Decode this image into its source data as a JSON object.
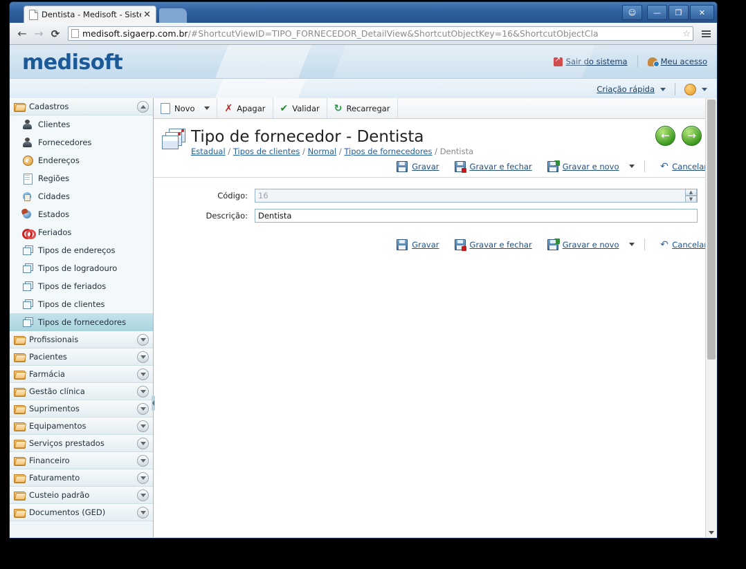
{
  "browser": {
    "tab_title": "Dentista - Medisoft - Sistema",
    "tab_close": "✕",
    "back_icon": "←",
    "forward_icon": "→",
    "reload_icon": "⟳",
    "url_host": "medisoft.sigaerp.com.br",
    "url_path": "/#ShortcutViewID=TIPO_FORNECEDOR_DetailView&ShortcutObjectKey=16&ShortcutObjectCla",
    "star_icon": "☆",
    "window_controls": {
      "user": "☺",
      "minimize": "—",
      "restore": "❐",
      "close": "✕"
    }
  },
  "header": {
    "logo": "medisoft",
    "logout_label": "Sair do sistema",
    "my_access_label": "Meu acesso",
    "quick_create_label": "Criação rápida"
  },
  "sidebar": {
    "groups": [
      {
        "label": "Cadastros",
        "expanded": true,
        "items": [
          {
            "label": "Clientes",
            "icon": "person-icon",
            "selected": false
          },
          {
            "label": "Fornecedores",
            "icon": "person-icon",
            "selected": false
          },
          {
            "label": "Endereços",
            "icon": "compass-icon",
            "selected": false
          },
          {
            "label": "Regiões",
            "icon": "document-icon",
            "selected": false
          },
          {
            "label": "Cidades",
            "icon": "city-icon",
            "selected": false
          },
          {
            "label": "Estados",
            "icon": "globe-icon",
            "selected": false
          },
          {
            "label": "Feriados",
            "icon": "rings-icon",
            "selected": false
          },
          {
            "label": "Tipos de endereços",
            "icon": "stack-icon",
            "selected": false
          },
          {
            "label": "Tipos de logradouro",
            "icon": "stack-icon",
            "selected": false
          },
          {
            "label": "Tipos de feriados",
            "icon": "stack-icon",
            "selected": false
          },
          {
            "label": "Tipos de clientes",
            "icon": "stack-icon",
            "selected": false
          },
          {
            "label": "Tipos de fornecedores",
            "icon": "stack-icon",
            "selected": true
          }
        ]
      },
      {
        "label": "Profissionais",
        "expanded": false,
        "items": []
      },
      {
        "label": "Pacientes",
        "expanded": false,
        "items": []
      },
      {
        "label": "Farmácia",
        "expanded": false,
        "items": []
      },
      {
        "label": "Gestão clínica",
        "expanded": false,
        "items": []
      },
      {
        "label": "Suprimentos",
        "expanded": false,
        "items": []
      },
      {
        "label": "Equipamentos",
        "expanded": false,
        "items": []
      },
      {
        "label": "Serviços prestados",
        "expanded": false,
        "items": []
      },
      {
        "label": "Financeiro",
        "expanded": false,
        "items": []
      },
      {
        "label": "Faturamento",
        "expanded": false,
        "items": []
      },
      {
        "label": "Custeio padrão",
        "expanded": false,
        "items": []
      },
      {
        "label": "Documentos (GED)",
        "expanded": false,
        "items": []
      }
    ]
  },
  "toolbar": {
    "new_label": "Novo",
    "delete_label": "Apagar",
    "validate_label": "Validar",
    "reload_label": "Recarregar"
  },
  "page": {
    "title": "Tipo de fornecedor - Dentista",
    "breadcrumb": [
      {
        "label": "Estadual",
        "link": true
      },
      {
        "label": "Tipos de clientes",
        "link": true
      },
      {
        "label": "Normal",
        "link": true
      },
      {
        "label": "Tipos de fornecedores",
        "link": true
      },
      {
        "label": "Dentista",
        "link": false
      }
    ],
    "breadcrumb_separator": "/",
    "nav_prev_icon": "←",
    "nav_next_icon": "→"
  },
  "actions": {
    "save_label": "Gravar",
    "save_close_label": "Gravar e fechar",
    "save_new_label": "Gravar e novo",
    "cancel_label": "Cancelar"
  },
  "form": {
    "code_label": "Código:",
    "code_value": "16",
    "code_readonly": true,
    "description_label": "Descrição:",
    "description_value": "Dentista"
  },
  "colors": {
    "brand_blue": "#1b5a96",
    "link_blue": "#215f9e",
    "selected_item": "#a8d5df",
    "chrome_blue": "#2f5f9e"
  }
}
